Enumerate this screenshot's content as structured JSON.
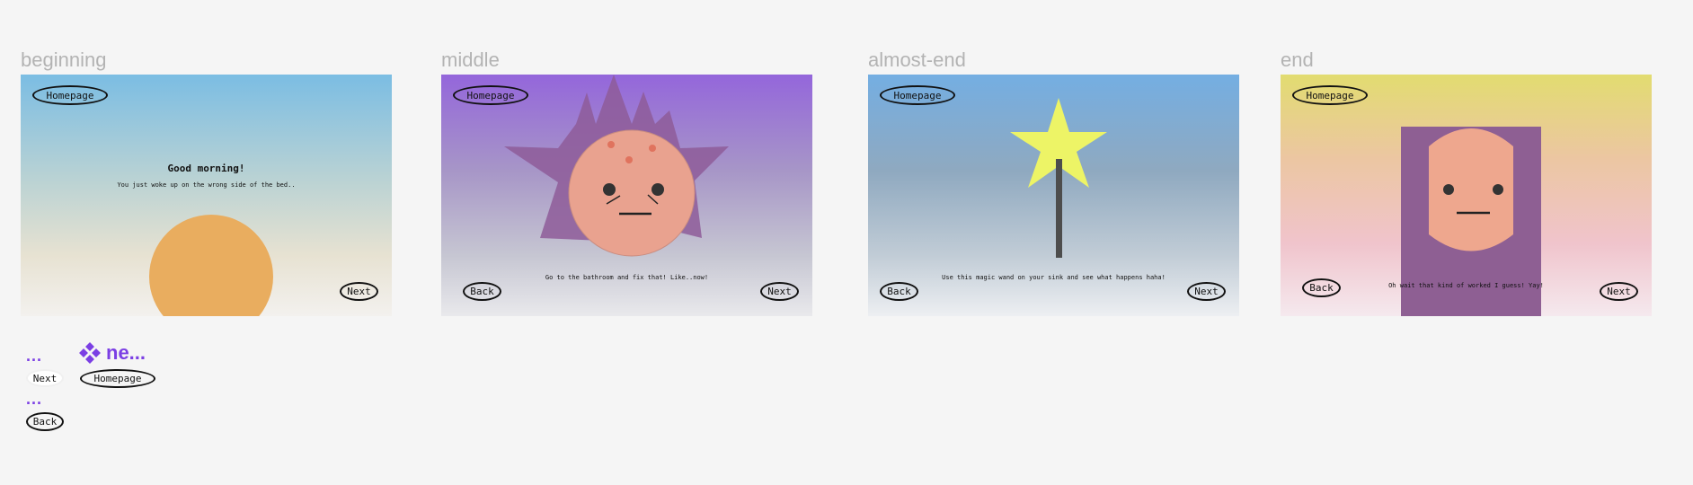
{
  "frames": {
    "beginning": {
      "label": "beginning",
      "homepage": "Homepage",
      "title": "Good morning!",
      "subtitle": "You just woke up on the wrong side of the bed..",
      "next": "Next"
    },
    "middle": {
      "label": "middle",
      "homepage": "Homepage",
      "caption": "Go to the bathroom and fix that! Like..now!",
      "back": "Back",
      "next": "Next"
    },
    "almost_end": {
      "label": "almost-end",
      "homepage": "Homepage",
      "caption": "Use this magic wand on your sink and see what happens haha!",
      "back": "Back",
      "next": "Next"
    },
    "end": {
      "label": "end",
      "homepage": "Homepage",
      "caption": "Oh wait that kind of worked I guess! Yay!",
      "back": "Back",
      "next": "Next"
    }
  },
  "components": {
    "dots_top": "...",
    "component_name": "ne...",
    "next_label": "Next",
    "homepage_label": "Homepage",
    "dots_bottom": "...",
    "back_label": "Back"
  },
  "colors": {
    "component_accent": "#7b3fe4",
    "frame_label": "#b3b3b3"
  }
}
